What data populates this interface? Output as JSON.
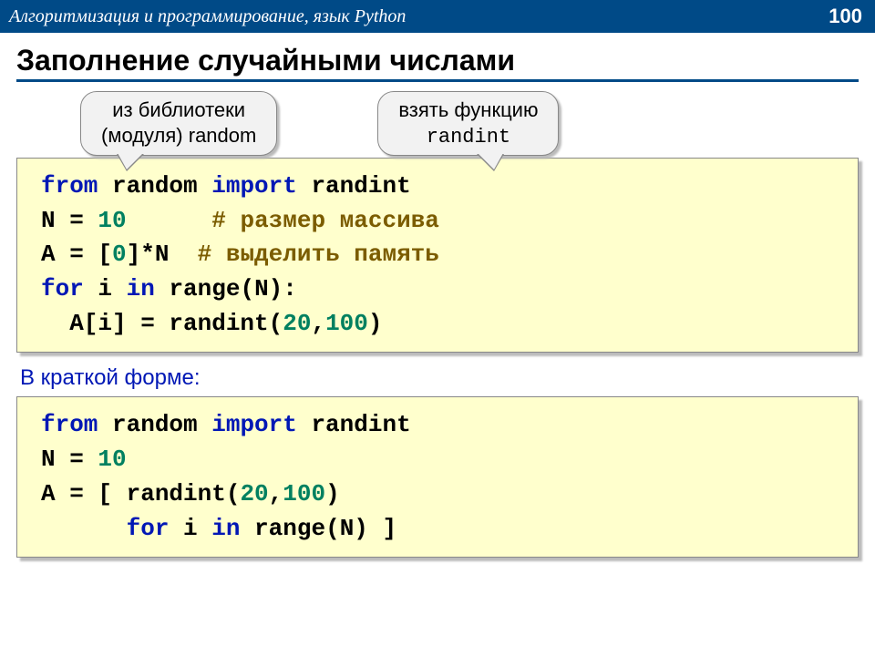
{
  "header": {
    "title": "Алгоритмизация и программирование, язык Python",
    "page": "100"
  },
  "title": "Заполнение случайными числами",
  "callout1_l1": "из библиотеки",
  "callout1_l2": "(модуля) random",
  "callout2_l1": "взять функцию",
  "callout2_l2": "randint",
  "code1": {
    "l1a": "from ",
    "l1b": "random ",
    "l1c": "import ",
    "l1d": "randint",
    "l2a": "N = ",
    "l2b": "10",
    "l2c": "      # размер массива",
    "l3a": "A = [",
    "l3b": "0",
    "l3c": "]*N  ",
    "l3d": "# выделить память",
    "l4a": "for ",
    "l4b": "i ",
    "l4c": "in ",
    "l4d": "range(N):",
    "l5a": "  A[i] = randint(",
    "l5b": "20",
    "l5c": ",",
    "l5d": "100",
    "l5e": ")"
  },
  "subtitle": "В краткой форме:",
  "code2": {
    "l1a": "from ",
    "l1b": "random ",
    "l1c": "import ",
    "l1d": "randint",
    "l2a": "N = ",
    "l2b": "10",
    "l3a": "A = [ randint(",
    "l3b": "20",
    "l3c": ",",
    "l3d": "100",
    "l3e": ") ",
    "l4a": "      for ",
    "l4b": "i ",
    "l4c": "in ",
    "l4d": "range(N) ]"
  }
}
